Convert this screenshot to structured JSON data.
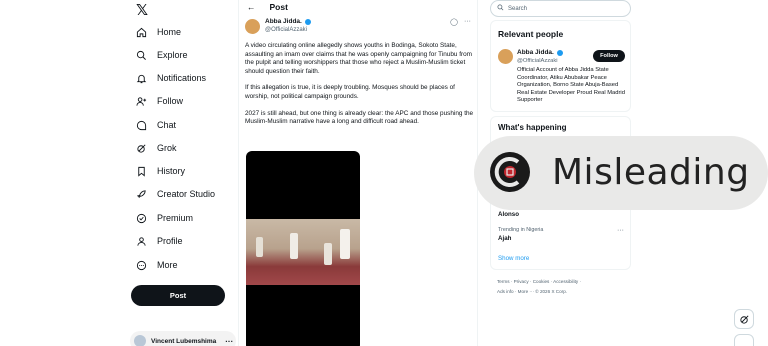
{
  "nav": {
    "logo": "𝕏",
    "items": [
      {
        "label": "Home",
        "icon": "home-icon"
      },
      {
        "label": "Explore",
        "icon": "search-icon"
      },
      {
        "label": "Notifications",
        "icon": "bell-icon"
      },
      {
        "label": "Follow",
        "icon": "person-add-icon"
      },
      {
        "label": "Chat",
        "icon": "chat-icon"
      },
      {
        "label": "Grok",
        "icon": "grok-icon"
      },
      {
        "label": "History",
        "icon": "bookmark-icon"
      },
      {
        "label": "Creator Studio",
        "icon": "rocket-icon"
      },
      {
        "label": "Premium",
        "icon": "premium-icon"
      },
      {
        "label": "Profile",
        "icon": "person-icon"
      },
      {
        "label": "More",
        "icon": "more-circle-icon"
      }
    ],
    "post_label": "Post",
    "user_name": "Vincent Lubemshima",
    "user_dots": "···"
  },
  "center": {
    "header_title": "Post",
    "back_glyph": "←",
    "author_name": "Abba Jidda.",
    "author_handle": "@OfficialAzzaki",
    "actions_glyph": "···",
    "paragraphs": [
      "A video circulating online allegedly shows youths in Bodinga, Sokoto State, assaulting an imam over claims that he was openly campaigning for Tinubu from the pulpit and telling worshippers that those who reject a Muslim-Muslim ticket should question their faith.",
      "If this allegation is true, it is deeply troubling. Mosques should be places of worship, not political campaign grounds.",
      "2027 is still ahead, but one thing is already clear: the APC and those pushing the Muslim-Muslim narrative have a long and difficult road ahead."
    ]
  },
  "right": {
    "search_placeholder": "Search",
    "relevant_title": "Relevant people",
    "rel_name": "Abba Jidda.",
    "rel_handle": "@OfficialAzzaki",
    "follow_label": "Follow",
    "rel_bio": "Official Account of Abba Jidda State Coordinator, Atiku Abubakar Peace Organization, Borno State Abuja-Based Real Estate Developer Proud Real Madrid Supporter",
    "happening_title": "What's happening",
    "trend1": "Alonso",
    "trend2_meta": "Trending in Nigeria",
    "trend2": "Ajah",
    "show_more": "Show more",
    "footer_line1": "Terms · Privacy · Cookies · Accessibility ·",
    "footer_line2": "Ads info · More ··· © 2026 X Corp."
  },
  "overlay": {
    "label": "Misleading",
    "bg_color": "#e9e9e8",
    "logo_color": "#1a1a1a",
    "accent_color": "#c0262d"
  }
}
